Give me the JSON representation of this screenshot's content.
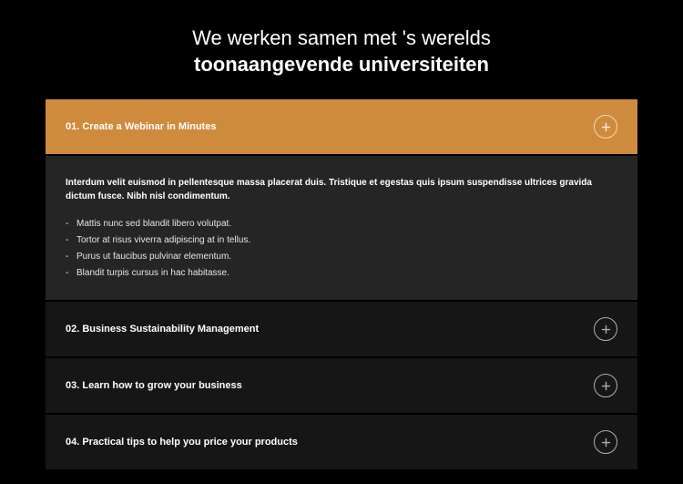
{
  "heading": {
    "line1": "We werken samen met 's werelds",
    "line2": "toonaangevende universiteiten"
  },
  "accordion": {
    "items": [
      {
        "title": "01. Create a Webinar in Minutes",
        "expanded": true,
        "content": {
          "intro": "Interdum velit euismod in pellentesque massa placerat duis. Tristique et egestas quis ipsum suspendisse ultrices gravida dictum fusce. Nibh nisl condimentum.",
          "bullets": [
            "Mattis nunc sed blandit libero volutpat.",
            "Tortor at risus viverra adipiscing at in tellus.",
            "Purus ut faucibus pulvinar elementum.",
            "Blandit turpis cursus in hac habitasse."
          ]
        }
      },
      {
        "title": "02. Business Sustainability Management",
        "expanded": false
      },
      {
        "title": "03. Learn how to grow your business",
        "expanded": false
      },
      {
        "title": "04. Practical tips to help you price your products",
        "expanded": false
      }
    ]
  }
}
